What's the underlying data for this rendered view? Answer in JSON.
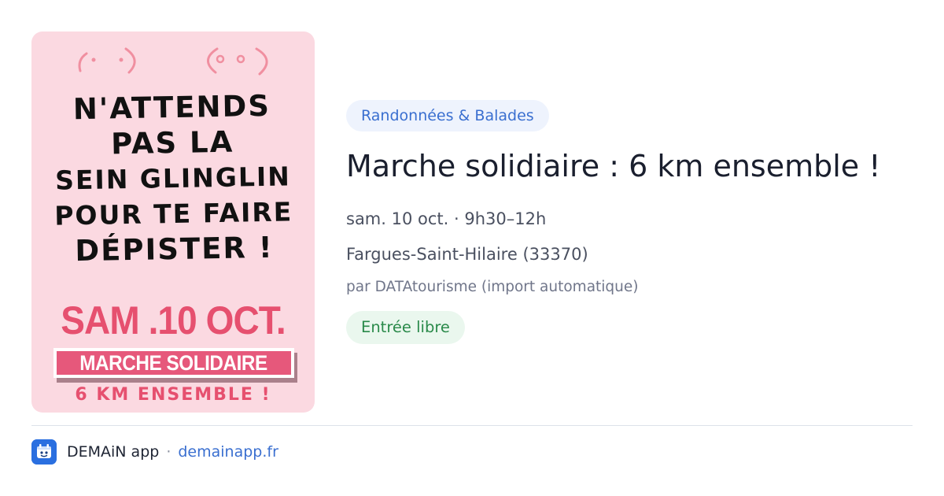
{
  "poster": {
    "headline": [
      "N'ATTENDS",
      "PAS LA",
      "SEIN GLINGLIN",
      "POUR TE FAIRE",
      "DÉPISTER !"
    ],
    "date": "SAM .10 OCT.",
    "banner": "MARCHE SOLIDAIRE",
    "subtitle": "6 KM ENSEMBLE !",
    "colors": {
      "background": "#fbd9e1",
      "accent": "#e6506f",
      "banner": "#e6587b"
    }
  },
  "event": {
    "category": "Randonnées & Balades",
    "title": "Marche solidiaire : 6 km ensemble !",
    "when": "sam. 10 oct. · 9h30–12h",
    "location": "Fargues-Saint-Hilaire (33370)",
    "source": "par DATAtourisme (import automatique)",
    "price": "Entrée libre"
  },
  "footer": {
    "app_icon": "demain-app-icon",
    "app_name": "DEMAiN app",
    "separator": "·",
    "site": "demainapp.fr"
  },
  "colors": {
    "tag_bg": "#eef3fd",
    "tag_text": "#3a6fd0",
    "price_bg": "#eaf7ee",
    "price_text": "#2a8a4a",
    "link": "#3a6fd0"
  }
}
